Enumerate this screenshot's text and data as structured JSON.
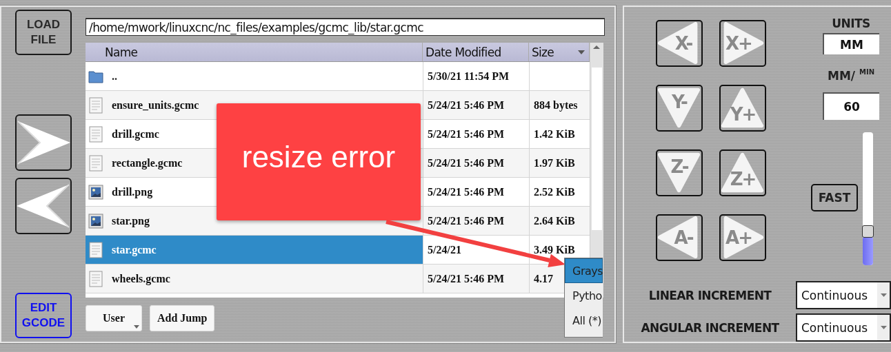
{
  "file_panel": {
    "load_button": "LOAD FILE",
    "nav_buttons": [
      {
        "kind": "next"
      },
      {
        "kind": "previous"
      }
    ],
    "edit_button": "EDIT GCODE",
    "path": "/home/mwork/linuxcnc/nc_files/examples/gcmc_lib/star.gcmc",
    "table": {
      "columns": [
        {
          "label": "Name",
          "sorted": false
        },
        {
          "label": "Date Modified",
          "sorted": false
        },
        {
          "label": "Size",
          "sorted": true
        }
      ],
      "rows": [
        {
          "kind": "folder",
          "name": "..",
          "date": "5/30/21 11:54 PM",
          "selected": false
        },
        {
          "kind": "text",
          "name": "ensure_units.gcmc",
          "date": "5/24/21 5:46 PM",
          "size": "884 bytes",
          "selected": false
        },
        {
          "kind": "text",
          "name": "drill.gcmc",
          "date": "5/24/21 5:46 PM",
          "size": "1.42 KiB",
          "selected": false
        },
        {
          "kind": "text",
          "name": "rectangle.gcmc",
          "date": "5/24/21 5:46 PM",
          "size": "1.97 KiB",
          "selected": false
        },
        {
          "kind": "image",
          "name": "drill.png",
          "date": "5/24/21 5:46 PM",
          "size": "2.52 KiB",
          "selected": false
        },
        {
          "kind": "image",
          "name": "star.png",
          "date": "5/24/21 5:46 PM",
          "size": "2.64 KiB",
          "selected": false
        },
        {
          "kind": "text",
          "name": "star.gcmc",
          "date": "5/24/21",
          "size": "3.49 KiB",
          "selected": true
        },
        {
          "kind": "text",
          "name": "wheels.gcmc",
          "date": "5/24/21 5:46 PM",
          "size": "4.17",
          "selected": false
        }
      ]
    },
    "buttons": [
      {
        "label": "User",
        "dropdown": true
      },
      {
        "label": "Add Jump",
        "dropdown": false
      }
    ],
    "filter_popup": {
      "items": [
        {
          "label": "Grays",
          "selected": true
        },
        {
          "label": "Pytho",
          "selected": false
        },
        {
          "label": "All (*)",
          "selected": false
        }
      ]
    }
  },
  "annotation": {
    "text": "resize error"
  },
  "jog_panel": {
    "jog_buttons": [
      {
        "label": "X-",
        "kind": "left"
      },
      {
        "label": "X+",
        "kind": "right"
      },
      {
        "label": "Y-",
        "kind": "down"
      },
      {
        "label": "Y+",
        "kind": "up"
      },
      {
        "label": "Z-",
        "kind": "down"
      },
      {
        "label": "Z+",
        "kind": "up"
      },
      {
        "label": "A-",
        "kind": "left"
      },
      {
        "label": "A+",
        "kind": "right"
      }
    ],
    "units_label": "UNITS",
    "units": "MM",
    "rate_label": "MM/ $^{MIN}$",
    "rate": "60",
    "fast_button": "FAST",
    "rate_slider": {
      "level": 0.22
    },
    "increments": [
      {
        "label": "LINEAR INCREMENT",
        "value": "Continuous"
      },
      {
        "label": "ANGULAR INCREMENT",
        "value": "Continuous"
      }
    ]
  }
}
